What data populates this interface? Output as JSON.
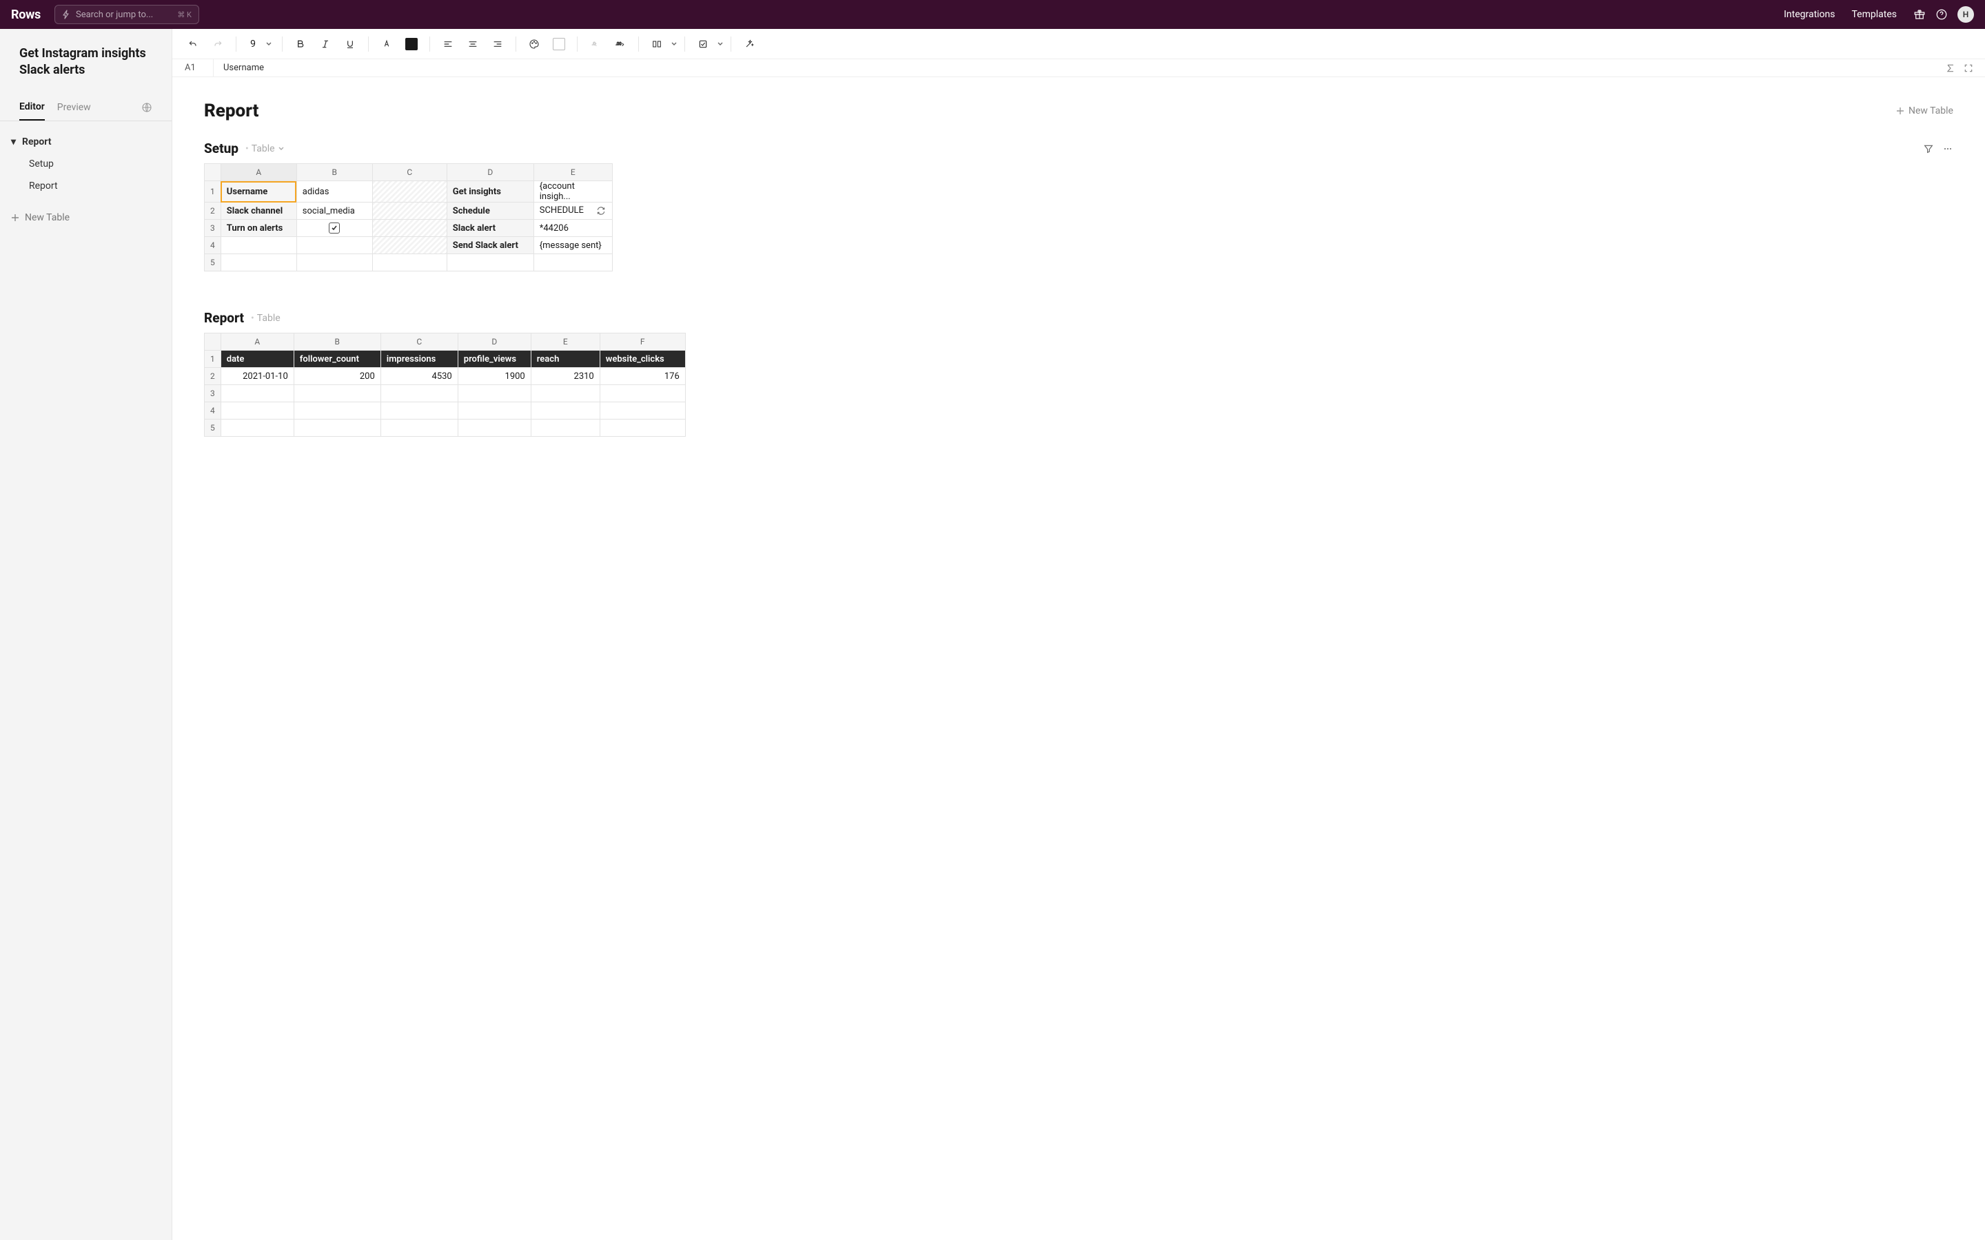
{
  "header": {
    "logo": "Rows",
    "search_placeholder": "Search or jump to...",
    "search_kbd": "⌘ K",
    "integrations": "Integrations",
    "templates": "Templates",
    "avatar_initial": "H"
  },
  "sidebar": {
    "title": "Get Instagram insights Slack alerts",
    "tabs": {
      "editor": "Editor",
      "preview": "Preview"
    },
    "tree": {
      "report": "Report",
      "setup": "Setup",
      "report_sub": "Report"
    },
    "new_table": "New Table"
  },
  "toolbar": {
    "font_size": "9"
  },
  "formula_bar": {
    "cell_ref": "A1",
    "cell_value": "Username"
  },
  "canvas": {
    "page_title": "Report",
    "new_table": "New Table",
    "sections": {
      "setup": {
        "title": "Setup",
        "meta": "Table",
        "columns": [
          "A",
          "B",
          "C",
          "D",
          "E"
        ],
        "rows": [
          {
            "a": "Username",
            "b": "adidas",
            "d": "Get insights",
            "e": "{account insigh..."
          },
          {
            "a": "Slack channel",
            "b": "social_media",
            "d": "Schedule",
            "e": "SCHEDULE",
            "refresh": true
          },
          {
            "a": "Turn on alerts",
            "b_checkbox": true,
            "d": "Slack alert",
            "e": "*44206"
          },
          {
            "a": "",
            "d": "Send Slack alert",
            "e": "{message sent}"
          },
          {
            "a": ""
          }
        ]
      },
      "report": {
        "title": "Report",
        "meta": "Table",
        "columns": [
          "A",
          "B",
          "C",
          "D",
          "E",
          "F"
        ],
        "headers": [
          "date",
          "follower_count",
          "impressions",
          "profile_views",
          "reach",
          "website_clicks"
        ],
        "data_row": [
          "2021-01-10",
          "200",
          "4530",
          "1900",
          "2310",
          "176"
        ]
      }
    }
  }
}
